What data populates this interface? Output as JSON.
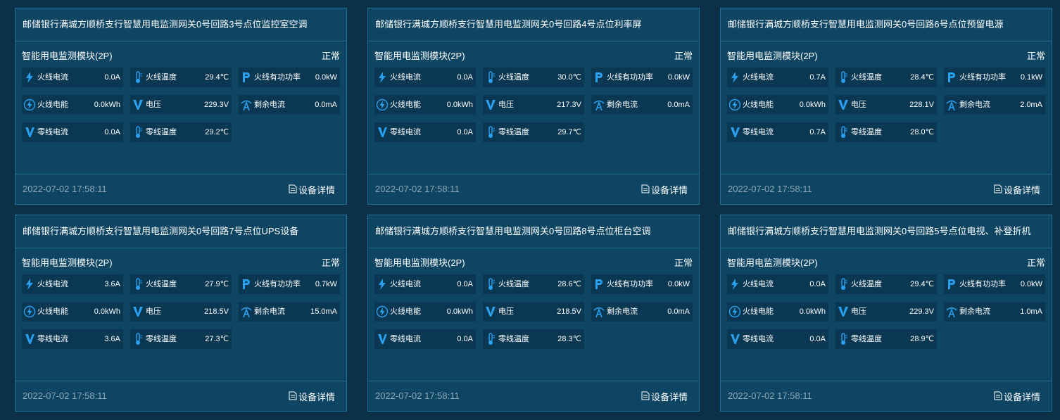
{
  "cards": [
    {
      "title": "邮储银行满城方顺桥支行智慧用电监测网关0号回路3号点位监控室空调",
      "module": "智能用电监测模块(2P)",
      "status": "正常",
      "timestamp": "2022-07-02 17:58:11",
      "detail_label": "设备详情",
      "metrics": [
        {
          "label": "火线电流",
          "value": "0.0A",
          "icon": "bolt-icon"
        },
        {
          "label": "火线温度",
          "value": "29.4℃",
          "icon": "thermometer-icon"
        },
        {
          "label": "火线有功功率",
          "value": "0.0kW",
          "icon": "power-p-icon"
        },
        {
          "label": "火线电能",
          "value": "0.0kWh",
          "icon": "energy-icon"
        },
        {
          "label": "电压",
          "value": "229.3V",
          "icon": "voltage-icon"
        },
        {
          "label": "剩余电流",
          "value": "0.0mA",
          "icon": "residual-current-icon"
        },
        {
          "label": "零线电流",
          "value": "0.0A",
          "icon": "neutral-current-icon"
        },
        {
          "label": "零线温度",
          "value": "29.2℃",
          "icon": "thermometer-icon"
        }
      ]
    },
    {
      "title": "邮储银行满城方顺桥支行智慧用电监测网关0号回路4号点位利率屏",
      "module": "智能用电监测模块(2P)",
      "status": "正常",
      "timestamp": "2022-07-02 17:58:11",
      "detail_label": "设备详情",
      "metrics": [
        {
          "label": "火线电流",
          "value": "0.0A",
          "icon": "bolt-icon"
        },
        {
          "label": "火线温度",
          "value": "30.0℃",
          "icon": "thermometer-icon"
        },
        {
          "label": "火线有功功率",
          "value": "0.0kW",
          "icon": "power-p-icon"
        },
        {
          "label": "火线电能",
          "value": "0.0kWh",
          "icon": "energy-icon"
        },
        {
          "label": "电压",
          "value": "217.3V",
          "icon": "voltage-icon"
        },
        {
          "label": "剩余电流",
          "value": "0.0mA",
          "icon": "residual-current-icon"
        },
        {
          "label": "零线电流",
          "value": "0.0A",
          "icon": "neutral-current-icon"
        },
        {
          "label": "零线温度",
          "value": "29.7℃",
          "icon": "thermometer-icon"
        }
      ]
    },
    {
      "title": "邮储银行满城方顺桥支行智慧用电监测网关0号回路6号点位预留电源",
      "module": "智能用电监测模块(2P)",
      "status": "正常",
      "timestamp": "2022-07-02 17:58:11",
      "detail_label": "设备详情",
      "metrics": [
        {
          "label": "火线电流",
          "value": "0.7A",
          "icon": "bolt-icon"
        },
        {
          "label": "火线温度",
          "value": "28.4℃",
          "icon": "thermometer-icon"
        },
        {
          "label": "火线有功功率",
          "value": "0.1kW",
          "icon": "power-p-icon"
        },
        {
          "label": "火线电能",
          "value": "0.0kWh",
          "icon": "energy-icon"
        },
        {
          "label": "电压",
          "value": "228.1V",
          "icon": "voltage-icon"
        },
        {
          "label": "剩余电流",
          "value": "2.0mA",
          "icon": "residual-current-icon"
        },
        {
          "label": "零线电流",
          "value": "0.7A",
          "icon": "neutral-current-icon"
        },
        {
          "label": "零线温度",
          "value": "28.0℃",
          "icon": "thermometer-icon"
        }
      ]
    },
    {
      "title": "邮储银行满城方顺桥支行智慧用电监测网关0号回路7号点位UPS设备",
      "module": "智能用电监测模块(2P)",
      "status": "正常",
      "timestamp": "2022-07-02 17:58:11",
      "detail_label": "设备详情",
      "metrics": [
        {
          "label": "火线电流",
          "value": "3.6A",
          "icon": "bolt-icon"
        },
        {
          "label": "火线温度",
          "value": "27.9℃",
          "icon": "thermometer-icon"
        },
        {
          "label": "火线有功功率",
          "value": "0.7kW",
          "icon": "power-p-icon"
        },
        {
          "label": "火线电能",
          "value": "0.0kWh",
          "icon": "energy-icon"
        },
        {
          "label": "电压",
          "value": "218.5V",
          "icon": "voltage-icon"
        },
        {
          "label": "剩余电流",
          "value": "15.0mA",
          "icon": "residual-current-icon"
        },
        {
          "label": "零线电流",
          "value": "3.6A",
          "icon": "neutral-current-icon"
        },
        {
          "label": "零线温度",
          "value": "27.3℃",
          "icon": "thermometer-icon"
        }
      ]
    },
    {
      "title": "邮储银行满城方顺桥支行智慧用电监测网关0号回路8号点位柜台空调",
      "module": "智能用电监测模块(2P)",
      "status": "正常",
      "timestamp": "2022-07-02 17:58:11",
      "detail_label": "设备详情",
      "metrics": [
        {
          "label": "火线电流",
          "value": "0.0A",
          "icon": "bolt-icon"
        },
        {
          "label": "火线温度",
          "value": "28.6℃",
          "icon": "thermometer-icon"
        },
        {
          "label": "火线有功功率",
          "value": "0.0kW",
          "icon": "power-p-icon"
        },
        {
          "label": "火线电能",
          "value": "0.0kWh",
          "icon": "energy-icon"
        },
        {
          "label": "电压",
          "value": "218.5V",
          "icon": "voltage-icon"
        },
        {
          "label": "剩余电流",
          "value": "0.0mA",
          "icon": "residual-current-icon"
        },
        {
          "label": "零线电流",
          "value": "0.0A",
          "icon": "neutral-current-icon"
        },
        {
          "label": "零线温度",
          "value": "28.3℃",
          "icon": "thermometer-icon"
        }
      ]
    },
    {
      "title": "邮储银行满城方顺桥支行智慧用电监测网关0号回路5号点位电视、补登折机",
      "module": "智能用电监测模块(2P)",
      "status": "正常",
      "timestamp": "2022-07-02 17:58:11",
      "detail_label": "设备详情",
      "metrics": [
        {
          "label": "火线电流",
          "value": "0.0A",
          "icon": "bolt-icon"
        },
        {
          "label": "火线温度",
          "value": "29.4℃",
          "icon": "thermometer-icon"
        },
        {
          "label": "火线有功功率",
          "value": "0.0kW",
          "icon": "power-p-icon"
        },
        {
          "label": "火线电能",
          "value": "0.0kWh",
          "icon": "energy-icon"
        },
        {
          "label": "电压",
          "value": "229.3V",
          "icon": "voltage-icon"
        },
        {
          "label": "剩余电流",
          "value": "1.0mA",
          "icon": "residual-current-icon"
        },
        {
          "label": "零线电流",
          "value": "0.0A",
          "icon": "neutral-current-icon"
        },
        {
          "label": "零线温度",
          "value": "28.9℃",
          "icon": "thermometer-icon"
        }
      ]
    }
  ],
  "colors": {
    "page_bg": "#0c3048",
    "card_bg": "#0d4563",
    "card_border": "#1d7196",
    "metric_bg": "#0a3852",
    "icon_blue": "#2aa0f0",
    "timestamp_text": "#8da7b6"
  }
}
